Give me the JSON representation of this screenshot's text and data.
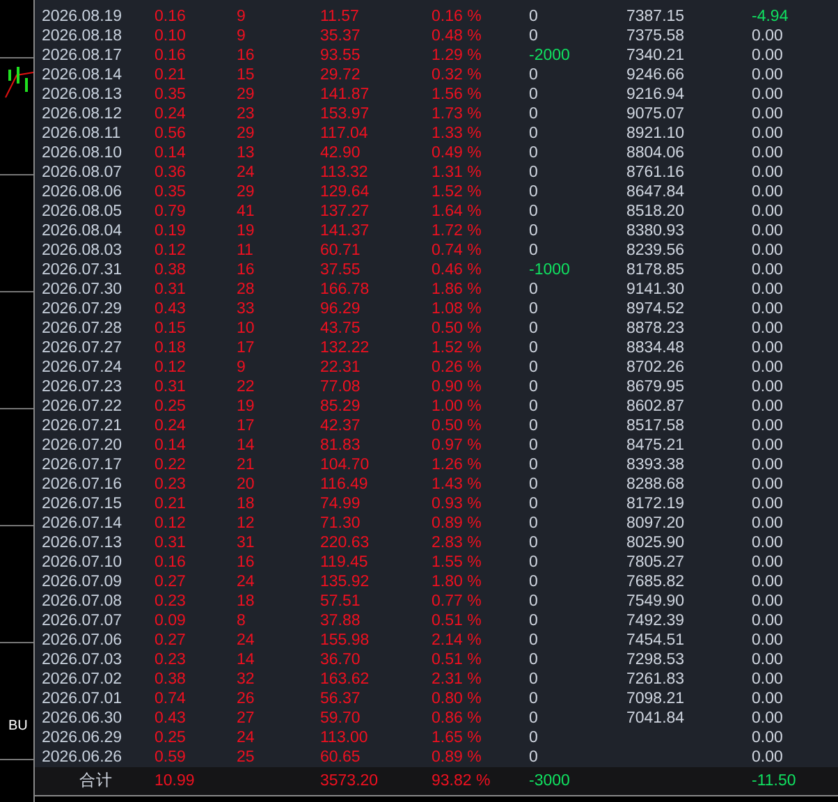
{
  "chart_strip": {
    "label": "BU"
  },
  "table": {
    "columns": [
      {
        "color": "#c9d2de"
      },
      {
        "color": "#f01020"
      },
      {
        "color": "#f01020"
      },
      {
        "color": "#f01020"
      },
      {
        "color": "#f01020"
      },
      {
        "color": "#d0d6e0"
      },
      {
        "color": "#d0d6e0"
      },
      {
        "color": "#d0d6e0"
      }
    ],
    "rows": [
      [
        "2026.08.19",
        "0.16",
        "9",
        "11.57",
        "0.16 %",
        "0",
        "7387.15",
        {
          "text": "-4.94",
          "color": "#10e060"
        }
      ],
      [
        "2026.08.18",
        "0.10",
        "9",
        "35.37",
        "0.48 %",
        "0",
        "7375.58",
        "0.00"
      ],
      [
        "2026.08.17",
        "0.16",
        "16",
        "93.55",
        "1.29 %",
        {
          "text": "-2000",
          "color": "#10e060"
        },
        "7340.21",
        "0.00"
      ],
      [
        "2026.08.14",
        "0.21",
        "15",
        "29.72",
        "0.32 %",
        "0",
        "9246.66",
        "0.00"
      ],
      [
        "2026.08.13",
        "0.35",
        "29",
        "141.87",
        "1.56 %",
        "0",
        "9216.94",
        "0.00"
      ],
      [
        "2026.08.12",
        "0.24",
        "23",
        "153.97",
        "1.73 %",
        "0",
        "9075.07",
        "0.00"
      ],
      [
        "2026.08.11",
        "0.56",
        "29",
        "117.04",
        "1.33 %",
        "0",
        "8921.10",
        "0.00"
      ],
      [
        "2026.08.10",
        "0.14",
        "13",
        "42.90",
        "0.49 %",
        "0",
        "8804.06",
        "0.00"
      ],
      [
        "2026.08.07",
        "0.36",
        "24",
        "113.32",
        "1.31 %",
        "0",
        "8761.16",
        "0.00"
      ],
      [
        "2026.08.06",
        "0.35",
        "29",
        "129.64",
        "1.52 %",
        "0",
        "8647.84",
        "0.00"
      ],
      [
        "2026.08.05",
        "0.79",
        "41",
        "137.27",
        "1.64 %",
        "0",
        "8518.20",
        "0.00"
      ],
      [
        "2026.08.04",
        "0.19",
        "19",
        "141.37",
        "1.72 %",
        "0",
        "8380.93",
        "0.00"
      ],
      [
        "2026.08.03",
        "0.12",
        "11",
        "60.71",
        "0.74 %",
        "0",
        "8239.56",
        "0.00"
      ],
      [
        "2026.07.31",
        "0.38",
        "16",
        "37.55",
        "0.46 %",
        {
          "text": "-1000",
          "color": "#10e060"
        },
        "8178.85",
        "0.00"
      ],
      [
        "2026.07.30",
        "0.31",
        "28",
        "166.78",
        "1.86 %",
        "0",
        "9141.30",
        "0.00"
      ],
      [
        "2026.07.29",
        "0.43",
        "33",
        "96.29",
        "1.08 %",
        "0",
        "8974.52",
        "0.00"
      ],
      [
        "2026.07.28",
        "0.15",
        "10",
        "43.75",
        "0.50 %",
        "0",
        "8878.23",
        "0.00"
      ],
      [
        "2026.07.27",
        "0.18",
        "17",
        "132.22",
        "1.52 %",
        "0",
        "8834.48",
        "0.00"
      ],
      [
        "2026.07.24",
        "0.12",
        "9",
        "22.31",
        "0.26 %",
        "0",
        "8702.26",
        "0.00"
      ],
      [
        "2026.07.23",
        "0.31",
        "22",
        "77.08",
        "0.90 %",
        "0",
        "8679.95",
        "0.00"
      ],
      [
        "2026.07.22",
        "0.25",
        "19",
        "85.29",
        "1.00 %",
        "0",
        "8602.87",
        "0.00"
      ],
      [
        "2026.07.21",
        "0.24",
        "17",
        "42.37",
        "0.50 %",
        "0",
        "8517.58",
        "0.00"
      ],
      [
        "2026.07.20",
        "0.14",
        "14",
        "81.83",
        "0.97 %",
        "0",
        "8475.21",
        "0.00"
      ],
      [
        "2026.07.17",
        "0.22",
        "21",
        "104.70",
        "1.26 %",
        "0",
        "8393.38",
        "0.00"
      ],
      [
        "2026.07.16",
        "0.23",
        "20",
        "116.49",
        "1.43 %",
        "0",
        "8288.68",
        "0.00"
      ],
      [
        "2026.07.15",
        "0.21",
        "18",
        "74.99",
        "0.93 %",
        "0",
        "8172.19",
        "0.00"
      ],
      [
        "2026.07.14",
        "0.12",
        "12",
        "71.30",
        "0.89 %",
        "0",
        "8097.20",
        "0.00"
      ],
      [
        "2026.07.13",
        "0.31",
        "31",
        "220.63",
        "2.83 %",
        "0",
        "8025.90",
        "0.00"
      ],
      [
        "2026.07.10",
        "0.16",
        "16",
        "119.45",
        "1.55 %",
        "0",
        "7805.27",
        "0.00"
      ],
      [
        "2026.07.09",
        "0.27",
        "24",
        "135.92",
        "1.80 %",
        "0",
        "7685.82",
        "0.00"
      ],
      [
        "2026.07.08",
        "0.23",
        "18",
        "57.51",
        "0.77 %",
        "0",
        "7549.90",
        "0.00"
      ],
      [
        "2026.07.07",
        "0.09",
        "8",
        "37.88",
        "0.51 %",
        "0",
        "7492.39",
        "0.00"
      ],
      [
        "2026.07.06",
        "0.27",
        "24",
        "155.98",
        "2.14 %",
        "0",
        "7454.51",
        "0.00"
      ],
      [
        "2026.07.03",
        "0.23",
        "14",
        "36.70",
        "0.51 %",
        "0",
        "7298.53",
        "0.00"
      ],
      [
        "2026.07.02",
        "0.38",
        "32",
        "163.62",
        "2.31 %",
        "0",
        "7261.83",
        "0.00"
      ],
      [
        "2026.07.01",
        "0.74",
        "26",
        "56.37",
        "0.80 %",
        "0",
        "7098.21",
        "0.00"
      ],
      [
        "2026.06.30",
        "0.43",
        "27",
        "59.70",
        "0.86 %",
        "0",
        "7041.84",
        "0.00"
      ],
      [
        "2026.06.29",
        "0.25",
        "24",
        "113.00",
        "1.65 %",
        "0",
        "",
        "0.00"
      ],
      [
        "2026.06.26",
        "0.59",
        "25",
        "60.65",
        "0.89 %",
        "0",
        "",
        "0.00"
      ]
    ],
    "total": {
      "label": "合计",
      "column_2": {
        "text": "10.99",
        "color": "#f01020"
      },
      "column_4": {
        "text": "3573.20",
        "color": "#f01020"
      },
      "column_5": {
        "text": "93.82 %",
        "color": "#f01020"
      },
      "column_6": {
        "text": "-3000",
        "color": "#10e060"
      },
      "column_8": {
        "text": "-11.50",
        "color": "#10e060"
      }
    }
  }
}
